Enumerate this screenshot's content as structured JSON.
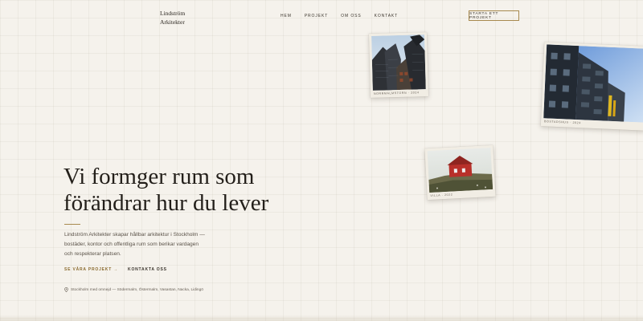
{
  "brand": {
    "line1": "Lindström",
    "line2": "Arkitekter"
  },
  "nav": [
    {
      "label": "HEM"
    },
    {
      "label": "PROJEKT"
    },
    {
      "label": "OM OSS"
    },
    {
      "label": "KONTAKT"
    }
  ],
  "cta": {
    "label": "STARTA ETT PROJEKT"
  },
  "hero": {
    "headline_line1": "Vi formger rum som",
    "headline_line2": "förändrar hur du lever",
    "lead": "Lindström Arkitekter skapar hållbar arkitektur i Stockholm — bostäder, kontor och offentliga rum som berikar vardagen och respekterar platsen.",
    "primary_link": "SE VÅRA PROJEKT →",
    "secondary_link": "KONTAKTA OSS",
    "location": "Stockholm med omnejd — Södermalm, Östermalm, Vasastan, Nacka, Lidingö"
  },
  "gallery": [
    {
      "caption": "NORRMALMSTORN · 2024"
    },
    {
      "caption": "BOSTADSHUS · 2024"
    },
    {
      "caption": "VILLA · 2022"
    }
  ],
  "colors": {
    "accent": "#a88a4f",
    "background": "#f5f2ec",
    "text": "#231f1a"
  }
}
